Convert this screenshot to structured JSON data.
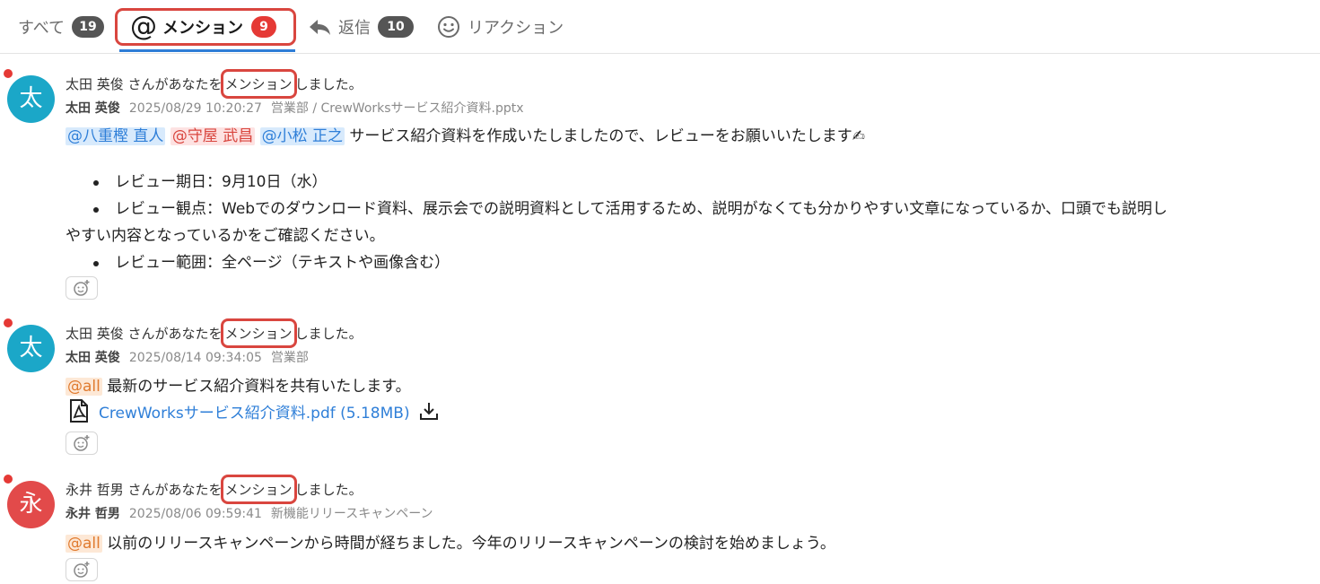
{
  "tabs": {
    "all": {
      "label": "すべて",
      "count": "19"
    },
    "mention": {
      "icon": "at-icon",
      "label": "メンション",
      "count": "9"
    },
    "reply": {
      "icon": "reply-icon",
      "label": "返信",
      "count": "10"
    },
    "reaction": {
      "icon": "smile-icon",
      "label": "リアクション"
    }
  },
  "colors": {
    "accent_blue": "#2e7dd7",
    "highlight_red": "#d9463f",
    "badge_red": "#e53935",
    "avatar_teal": "#1ba7c8",
    "avatar_red": "#e24a4a"
  },
  "messages": [
    {
      "avatar_char": "太",
      "notice_pre": "太田 英俊 さんがあなたを",
      "notice_highlight": "メンション",
      "notice_post": "しました。",
      "author": "太田 英俊",
      "date": "2025/08/29 10:20:27",
      "channel": "営業部 / CrewWorksサービス紹介資料.pptx",
      "mentions": [
        "@八重樫 直人",
        "@守屋 武昌",
        "@小松 正之"
      ],
      "text": " サービス紹介資料を作成いたしましたので、レビューをお願いいたします✍",
      "bullets": [
        "レビュー期日：9月10日（水）",
        "レビュー観点：Webでのダウンロード資料、展示会での説明資料として活用するため、説明がなくても分かりやすい文章になっているか、口頭でも説明し",
        "やすい内容となっているかをご確認ください。",
        "レビュー範囲：全ページ（テキストや画像含む）"
      ]
    },
    {
      "avatar_char": "太",
      "notice_pre": "太田 英俊 さんがあなたを",
      "notice_highlight": "メンション",
      "notice_post": "しました。",
      "author": "太田 英俊",
      "date": "2025/08/14 09:34:05",
      "channel": "営業部",
      "mention": "@all",
      "text": " 最新のサービス紹介資料を共有いたします。",
      "file": "CrewWorksサービス紹介資料.pdf (5.18MB)"
    },
    {
      "avatar_char": "永",
      "notice_pre": "永井 哲男 さんがあなたを",
      "notice_highlight": "メンション",
      "notice_post": "しました。",
      "author": "永井 哲男",
      "date": "2025/08/06 09:59:41",
      "channel": "新機能リリースキャンペーン",
      "mention": "@all",
      "text": " 以前のリリースキャンペーンから時間が経ちました。今年のリリースキャンペーンの検討を始めましょう。"
    }
  ]
}
